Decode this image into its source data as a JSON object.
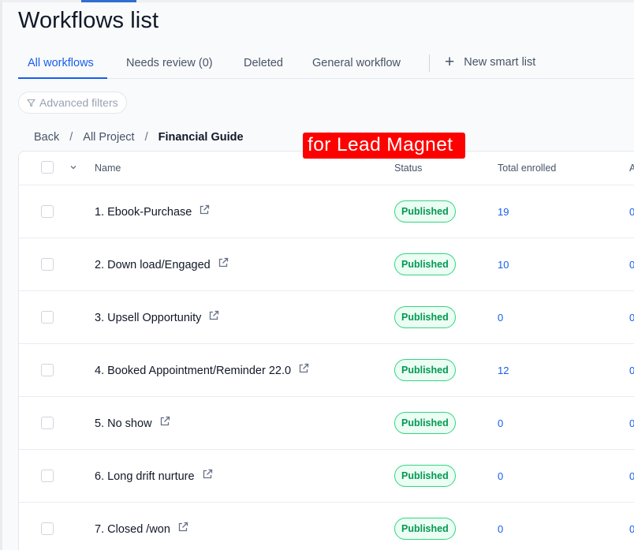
{
  "page_title": "Workflows list",
  "tabs": [
    {
      "label": "All workflows",
      "active": true
    },
    {
      "label": "Needs review (0)",
      "active": false
    },
    {
      "label": "Deleted",
      "active": false
    },
    {
      "label": "General workflow",
      "active": false
    }
  ],
  "new_smart_list_label": "New smart list",
  "advanced_filters_label": "Advanced filters",
  "breadcrumb": {
    "back": "Back",
    "sep": "/",
    "project": "All Project",
    "current": "Financial Guide"
  },
  "annotation_text": "for Lead Magnet",
  "table": {
    "columns": {
      "name": "Name",
      "status": "Status",
      "total_enrolled": "Total enrolled",
      "next_col_partial": "A"
    },
    "rows": [
      {
        "name": "1. Ebook-Purchase",
        "status": "Published",
        "enrolled": "19",
        "next": "0"
      },
      {
        "name": "2. Down load/Engaged",
        "status": "Published",
        "enrolled": "10",
        "next": "0"
      },
      {
        "name": "3. Upsell Opportunity",
        "status": "Published",
        "enrolled": "0",
        "next": "0"
      },
      {
        "name": "4. Booked Appointment/Reminder 22.0",
        "status": "Published",
        "enrolled": "12",
        "next": "0"
      },
      {
        "name": "5. No show",
        "status": "Published",
        "enrolled": "0",
        "next": "0"
      },
      {
        "name": "6. Long drift nurture",
        "status": "Published",
        "enrolled": "0",
        "next": "0"
      },
      {
        "name": "7. Closed /won",
        "status": "Published",
        "enrolled": "0",
        "next": "0"
      }
    ]
  },
  "colors": {
    "accent": "#155eef",
    "published_text": "#039855",
    "published_bg": "#ecfdf3",
    "annotation_bg": "#ff0000"
  }
}
